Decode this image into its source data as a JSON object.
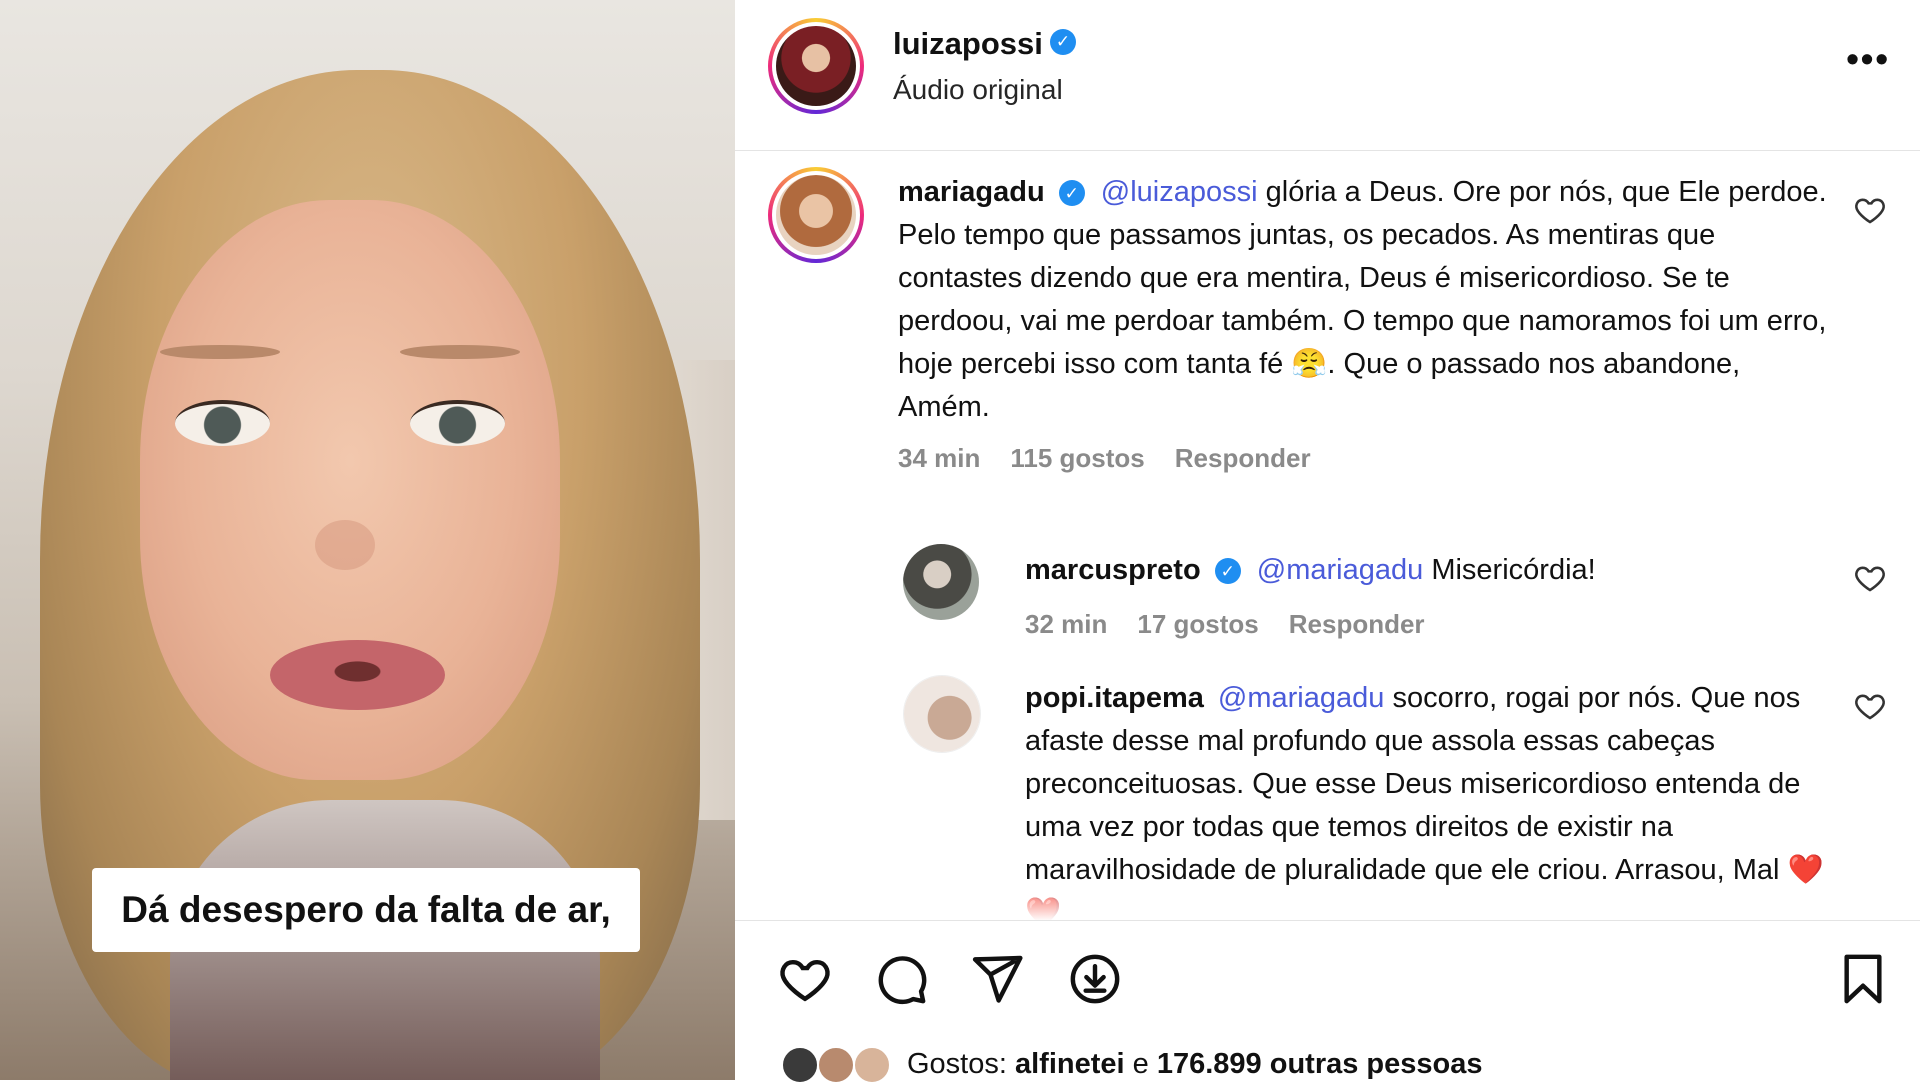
{
  "video": {
    "caption": "Dá desespero da falta de ar,"
  },
  "post": {
    "author": "luizapossi",
    "audio_label": "Áudio original",
    "more_label": "•••"
  },
  "comments": [
    {
      "username": "mariagadu",
      "mention": "@luizapossi",
      "text": "glória a Deus. Ore por nós, que Ele perdoe. Pelo tempo que passamos juntas, os pecados. As mentiras que contastes dizendo que era mentira, Deus é misericordioso. Se te perdoou, vai me perdoar também. O tempo que namoramos foi um erro, hoje percebi isso com tanta fé 😤. Que o passado nos abandone, Amém.",
      "time": "34 min",
      "likes": "115 gostos",
      "reply": "Responder"
    },
    {
      "username": "marcuspreto",
      "mention": "@mariagadu",
      "text": "Misericórdia!",
      "time": "32 min",
      "likes": "17 gostos",
      "reply": "Responder"
    },
    {
      "username": "popi.itapema",
      "mention": "@mariagadu",
      "text": "socorro, rogai por nós. Que nos afaste desse mal profundo que assola essas cabeças preconceituosas. Que esse Deus misericordioso entenda de uma vez por todas que temos direitos de existir na maravilhosidade de pluralidade que ele criou. Arrasou, Mal ❤️❤️"
    }
  ],
  "likes_summary": {
    "prefix": "Gostos:",
    "first_liker": "alfinetei",
    "connector": "e",
    "others": "176.899 outras pessoas"
  },
  "icons": {
    "like": "heart-icon",
    "comment": "comment-bubble-icon",
    "share": "paper-plane-icon",
    "download": "download-icon",
    "save": "bookmark-icon",
    "verified": "verified-badge-icon"
  },
  "colors": {
    "mention": "#4a5bd9",
    "verified": "#1f8ef1",
    "meta_gray": "#8a8a8a"
  }
}
